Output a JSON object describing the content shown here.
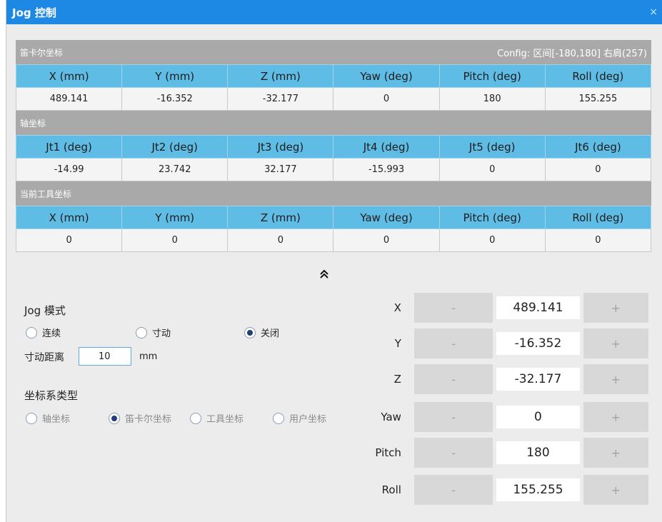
{
  "window": {
    "title": "Jog 控制",
    "close_glyph": "×"
  },
  "cartesian": {
    "header": "笛卡尔坐标",
    "config": "Config: 区间[-180,180]  右肩(257)",
    "columns": [
      "X (mm)",
      "Y (mm)",
      "Z (mm)",
      "Yaw (deg)",
      "Pitch (deg)",
      "Roll (deg)"
    ],
    "values": [
      "489.141",
      "-16.352",
      "-32.177",
      "0",
      "180",
      "155.255"
    ]
  },
  "joint": {
    "header": "轴坐标",
    "columns": [
      "Jt1 (deg)",
      "Jt2 (deg)",
      "Jt3 (deg)",
      "Jt4 (deg)",
      "Jt5 (deg)",
      "Jt6 (deg)"
    ],
    "values": [
      "-14.99",
      "23.742",
      "32.177",
      "-15.993",
      "0",
      "0"
    ]
  },
  "tool": {
    "header": "当前工具坐标",
    "columns": [
      "X (mm)",
      "Y (mm)",
      "Z (mm)",
      "Yaw (deg)",
      "Pitch (deg)",
      "Roll (deg)"
    ],
    "values": [
      "0",
      "0",
      "0",
      "0",
      "0",
      "0"
    ]
  },
  "collapse_icon": "chevron-double-up",
  "jog_mode": {
    "label": "Jog 模式",
    "options": [
      "连续",
      "寸动",
      "关闭"
    ],
    "selected": "关闭"
  },
  "step_distance": {
    "label": "寸动距离",
    "value": "10",
    "unit": "mm"
  },
  "coord_type": {
    "label": "坐标系类型",
    "options": [
      "轴坐标",
      "笛卡尔坐标",
      "工具坐标",
      "用户坐标"
    ],
    "selected": "笛卡尔坐标"
  },
  "jog_axes": [
    {
      "label": "X",
      "value": "489.141"
    },
    {
      "label": "Y",
      "value": "-16.352"
    },
    {
      "label": "Z",
      "value": "-32.177"
    },
    {
      "label": "Yaw",
      "value": "0"
    },
    {
      "label": "Pitch",
      "value": "180"
    },
    {
      "label": "Roll",
      "value": "155.255"
    }
  ],
  "jog_buttons": {
    "minus": "-",
    "plus": "+"
  },
  "colors": {
    "titlebar": "#1e88e5",
    "table_header": "#5fbce4",
    "section_header": "#a9a9a9"
  }
}
